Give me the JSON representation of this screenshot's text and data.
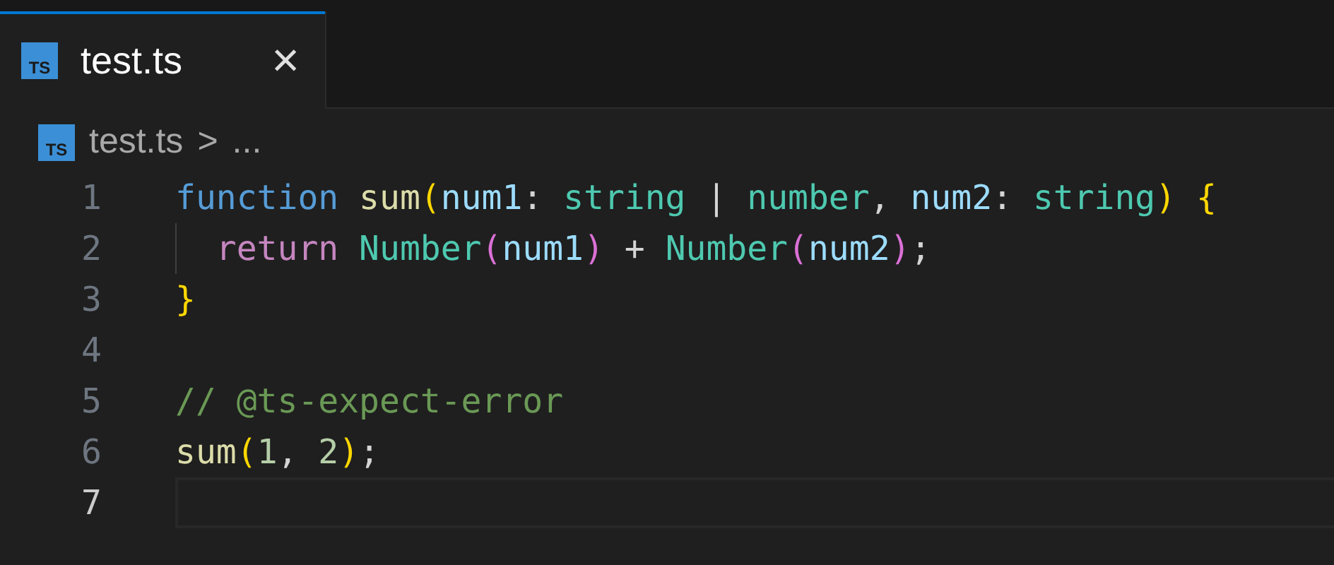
{
  "tabs": [
    {
      "label": "test.ts",
      "icon_text": "TS",
      "selected": true,
      "close": "×"
    }
  ],
  "breadcrumb": {
    "icon_text": "TS",
    "file": "test.ts",
    "separator": ">",
    "more": "..."
  },
  "lines": [
    {
      "number": "1",
      "current": false,
      "indent_guide": false,
      "tokens": [
        {
          "text": "function ",
          "kind": "keyword"
        },
        {
          "text": "sum",
          "kind": "function"
        },
        {
          "text": "(",
          "kind": "bracket1"
        },
        {
          "text": "num1",
          "kind": "param"
        },
        {
          "text": ": ",
          "kind": "plain"
        },
        {
          "text": "string",
          "kind": "type"
        },
        {
          "text": " | ",
          "kind": "plain"
        },
        {
          "text": "number",
          "kind": "type"
        },
        {
          "text": ", ",
          "kind": "plain"
        },
        {
          "text": "num2",
          "kind": "param"
        },
        {
          "text": ": ",
          "kind": "plain"
        },
        {
          "text": "string",
          "kind": "type"
        },
        {
          "text": ")",
          "kind": "bracket1"
        },
        {
          "text": " {",
          "kind": "bracket1"
        }
      ]
    },
    {
      "number": "2",
      "current": false,
      "indent_guide": true,
      "tokens": [
        {
          "text": "  return ",
          "kind": "control"
        },
        {
          "text": "Number",
          "kind": "type"
        },
        {
          "text": "(",
          "kind": "bracket2"
        },
        {
          "text": "num1",
          "kind": "param"
        },
        {
          "text": ")",
          "kind": "bracket2"
        },
        {
          "text": " + ",
          "kind": "plain"
        },
        {
          "text": "Number",
          "kind": "type"
        },
        {
          "text": "(",
          "kind": "bracket2"
        },
        {
          "text": "num2",
          "kind": "param"
        },
        {
          "text": ")",
          "kind": "bracket2"
        },
        {
          "text": ";",
          "kind": "plain"
        }
      ]
    },
    {
      "number": "3",
      "current": false,
      "indent_guide": false,
      "tokens": [
        {
          "text": "}",
          "kind": "bracket1"
        }
      ]
    },
    {
      "number": "4",
      "current": false,
      "indent_guide": false
    },
    {
      "number": "5",
      "current": false,
      "indent_guide": false,
      "tokens": [
        {
          "text": "// @ts-expect-error",
          "kind": "comment"
        }
      ]
    },
    {
      "number": "6",
      "current": false,
      "indent_guide": false,
      "tokens": [
        {
          "text": "sum",
          "kind": "function"
        },
        {
          "text": "(",
          "kind": "bracket1"
        },
        {
          "text": "1",
          "kind": "number"
        },
        {
          "text": ", ",
          "kind": "plain"
        },
        {
          "text": "2",
          "kind": "number"
        },
        {
          "text": ")",
          "kind": "bracket1"
        },
        {
          "text": ";",
          "kind": "plain"
        }
      ]
    },
    {
      "number": "7",
      "current": true,
      "indent_guide": false
    }
  ]
}
